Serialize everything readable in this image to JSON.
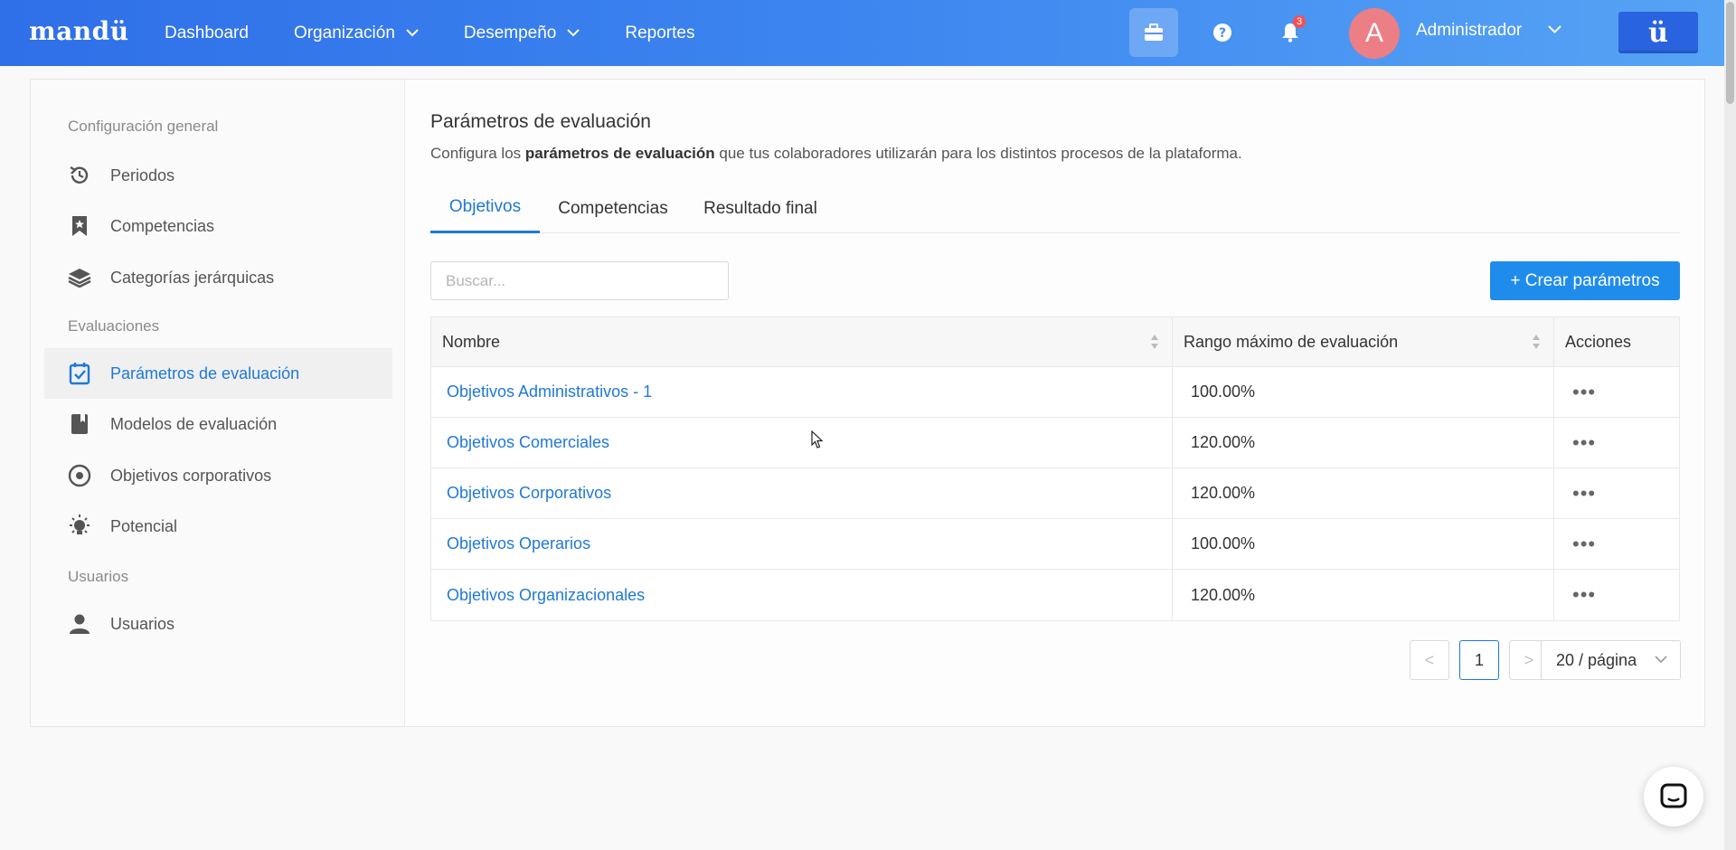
{
  "brand": "mandü",
  "nav": {
    "dashboard": "Dashboard",
    "organizacion": "Organización",
    "desempeno": "Desempeño",
    "reportes": "Reportes"
  },
  "header": {
    "notifications_count": "3",
    "avatar_initial": "A",
    "username": "Administrador",
    "logo_badge": "ü"
  },
  "sidebar": {
    "sections": [
      "Configuración general",
      "Evaluaciones",
      "Usuarios"
    ],
    "items": [
      {
        "label": "Periodos",
        "icon": "history-icon"
      },
      {
        "label": "Competencias",
        "icon": "bookmark-icon"
      },
      {
        "label": "Categorías jerárquicas",
        "icon": "layers-icon"
      },
      {
        "label": "Parámetros de evaluación",
        "icon": "calendar-check-icon",
        "active": true
      },
      {
        "label": "Modelos de evaluación",
        "icon": "book-icon"
      },
      {
        "label": "Objetivos corporativos",
        "icon": "target-icon"
      },
      {
        "label": "Potencial",
        "icon": "bulb-icon"
      },
      {
        "label": "Usuarios",
        "icon": "user-icon"
      }
    ]
  },
  "main": {
    "title": "Parámetros de evaluación",
    "subtitle_pre": "Configura los ",
    "subtitle_bold": "parámetros de evaluación",
    "subtitle_post": " que tus colaboradores utilizarán para los distintos procesos de la plataforma.",
    "tabs": [
      "Objetivos",
      "Competencias",
      "Resultado final"
    ],
    "active_tab": "Objetivos",
    "search_placeholder": "Buscar...",
    "create_button": "+ Crear parámetros"
  },
  "table": {
    "columns": [
      "Nombre",
      "Rango máximo de evaluación",
      "Acciones"
    ],
    "rows": [
      {
        "name": "Objetivos Administrativos - 1",
        "range": "100.00%"
      },
      {
        "name": "Objetivos Comerciales",
        "range": "120.00%"
      },
      {
        "name": "Objetivos Corporativos",
        "range": "120.00%"
      },
      {
        "name": "Objetivos Operarios",
        "range": "100.00%"
      },
      {
        "name": "Objetivos Organizacionales",
        "range": "120.00%"
      }
    ],
    "actions_label": "•••"
  },
  "pagination": {
    "prev": "<",
    "current_page": "1",
    "next": ">",
    "page_size": "20 / página"
  },
  "colors": {
    "accent": "#1f78d8",
    "button": "#1f8cec",
    "topbar_start": "#2f6fe8",
    "topbar_end": "#56a4f5"
  }
}
